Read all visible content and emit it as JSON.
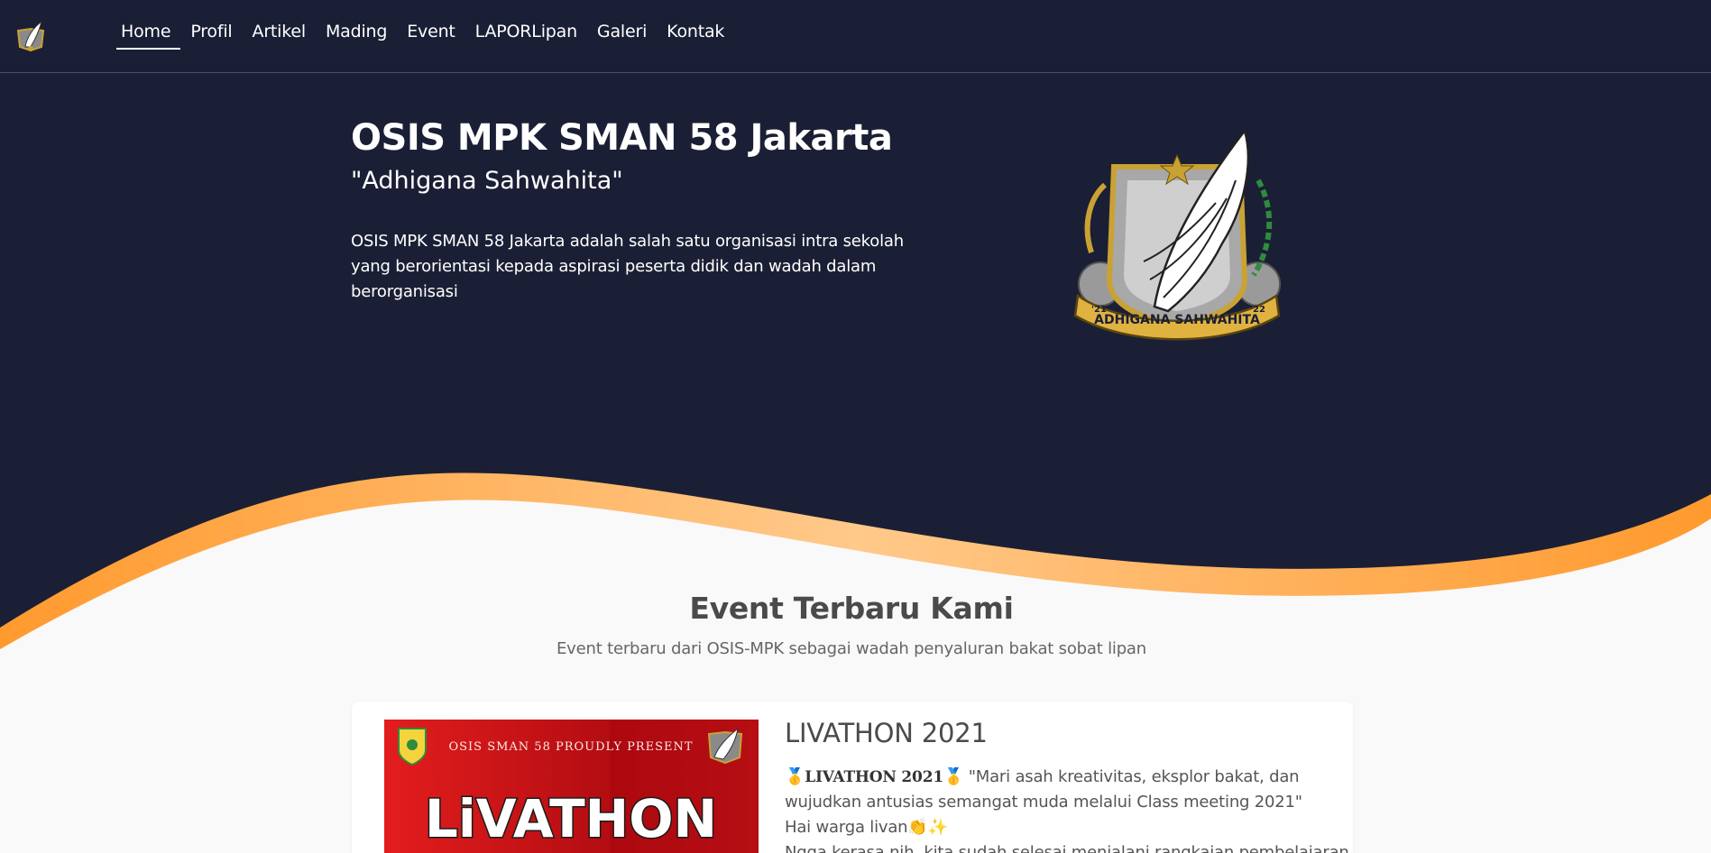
{
  "colors": {
    "nav_bg": "#1b1f35",
    "accent_orange": "#ff9a2e",
    "page_bg": "#f9f9f9"
  },
  "nav": {
    "logo_icon": "osis-wing-logo-icon",
    "links": [
      {
        "label": "Home",
        "active": true
      },
      {
        "label": "Profil"
      },
      {
        "label": "Artikel"
      },
      {
        "label": "Mading"
      },
      {
        "label": "Event"
      },
      {
        "label": "LAPORLipan"
      },
      {
        "label": "Galeri"
      },
      {
        "label": "Kontak"
      }
    ]
  },
  "hero": {
    "title": "OSIS MPK SMAN 58 Jakarta",
    "subtitle": "\"Adhigana Sahwahita\"",
    "description": "OSIS MPK SMAN 58 Jakarta adalah salah satu organisasi intra sekolah yang berorientasi kepada aspirasi peserta didik dan wadah dalam berorganisasi",
    "emblem_banner": "ADHIGANA SAHWAHITA",
    "emblem_year_left": "'21",
    "emblem_year_right": "'22"
  },
  "events": {
    "title": "Event Terbaru Kami",
    "subtitle": "Event terbaru dari OSIS-MPK sebagai wadah penyaluran bakat sobat lipan",
    "items": [
      {
        "title": "LIVATHON 2021",
        "image_header": "OSIS SMAN 58 PROUDLY PRESENT",
        "image_word": "LiVATHON",
        "lead_bold": "LIVATHON 2021",
        "lead_rest": " \"Mari asah kreativitas, eksplor bakat, dan",
        "line2": "wujudkan antusias semangat muda melalui Class meeting 2021\"",
        "line3": "Hai warga livan",
        "line4": "Ngga kerasa nih, kita sudah selesai menjalani rangkaian pembelajaran"
      }
    ]
  }
}
